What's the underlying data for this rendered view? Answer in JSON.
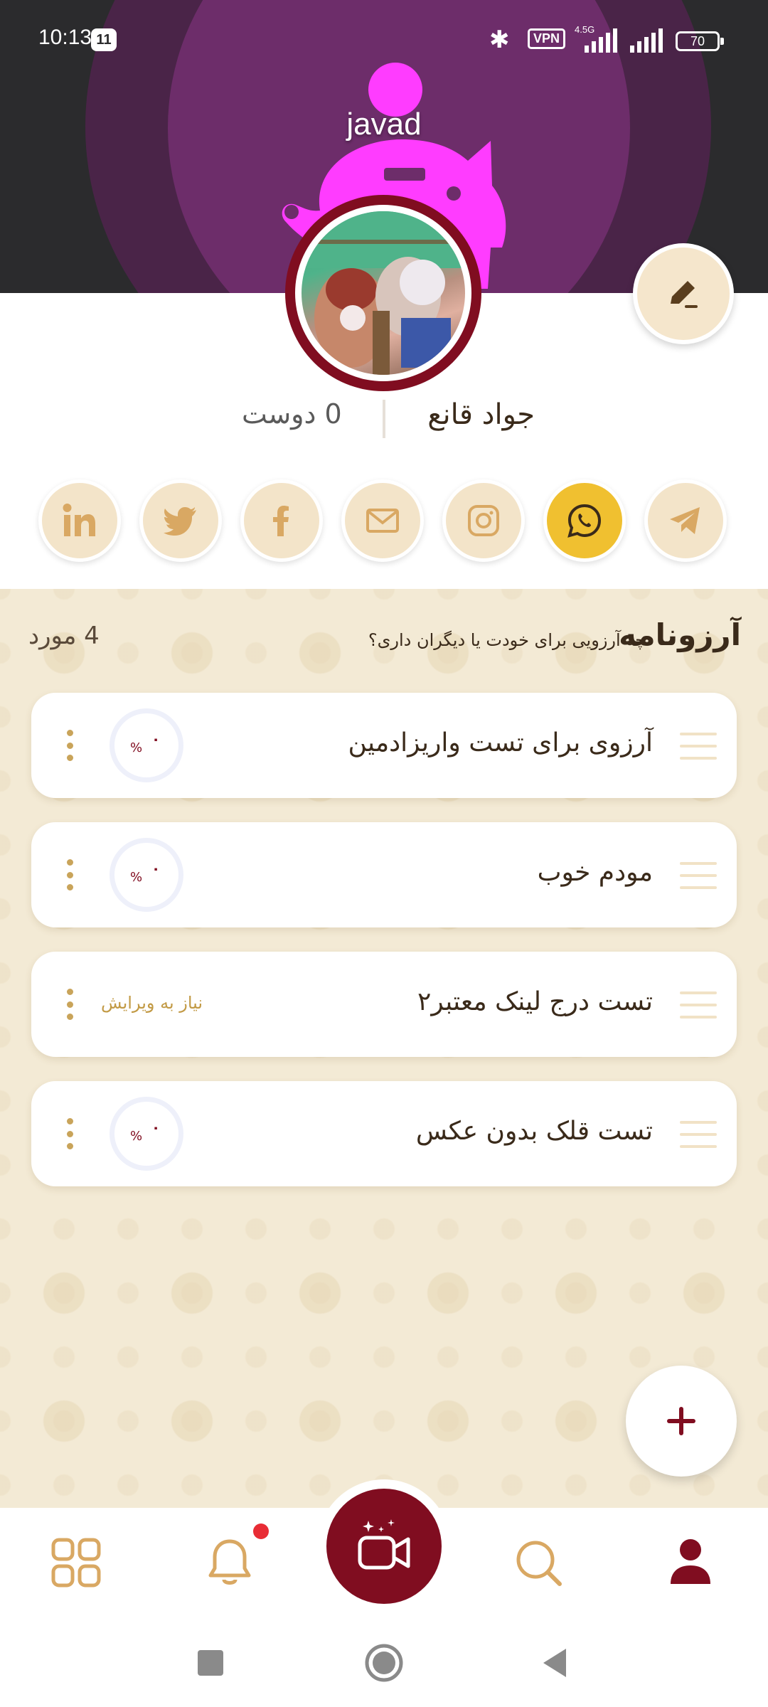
{
  "status_bar": {
    "time": "10:13",
    "notification_badge": "11",
    "vpn": "VPN",
    "network": "4.5G",
    "battery": "70"
  },
  "profile": {
    "username": "javad",
    "full_name": "جواد قانع",
    "friends": "0 دوست"
  },
  "socials": [
    {
      "icon": "linkedin-icon",
      "active": false
    },
    {
      "icon": "twitter-icon",
      "active": false
    },
    {
      "icon": "facebook-icon",
      "active": false
    },
    {
      "icon": "email-icon",
      "active": false
    },
    {
      "icon": "instagram-icon",
      "active": false
    },
    {
      "icon": "whatsapp-icon",
      "active": true
    },
    {
      "icon": "telegram-icon",
      "active": false
    }
  ],
  "wishlist": {
    "title": "آرزونامه",
    "subtitle": "چه آرزویی برای خودت یا دیگران داری؟",
    "count": "4 مورد",
    "items": [
      {
        "title": "آرزوی برای تست واریزادمین",
        "progress_percent": "%",
        "progress_value": "۰"
      },
      {
        "title": "مودم خوب",
        "progress_percent": "%",
        "progress_value": "۰"
      },
      {
        "title": "تست درج لینک معتبر۲",
        "status": "نیاز به ویرایش"
      },
      {
        "title": "تست قلک بدون عکس",
        "progress_percent": "%",
        "progress_value": "۰"
      }
    ]
  },
  "colors": {
    "brand": "#800d20",
    "accent": "#c9a45a",
    "header_bg": "#2b2b2d",
    "header_circle": "#6d2d6a",
    "pig": "#ff3cff",
    "whatsapp_active": "#f0c030",
    "notification_dot": "#e82c35"
  },
  "bottom_nav": {
    "items": [
      "grid-icon",
      "bell-icon",
      "video-camera-icon",
      "search-icon",
      "profile-icon"
    ],
    "has_notification": true
  }
}
